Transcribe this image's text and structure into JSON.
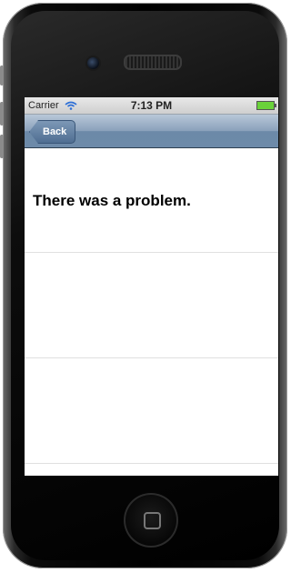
{
  "status_bar": {
    "carrier": "Carrier",
    "time": "7:13 PM",
    "wifi_icon": "wifi-icon",
    "battery_icon": "battery-icon",
    "battery_color": "#6ad23a"
  },
  "nav_bar": {
    "back_label": "Back",
    "bar_color": "#6d8aa9"
  },
  "content": {
    "message": "There was a problem."
  }
}
